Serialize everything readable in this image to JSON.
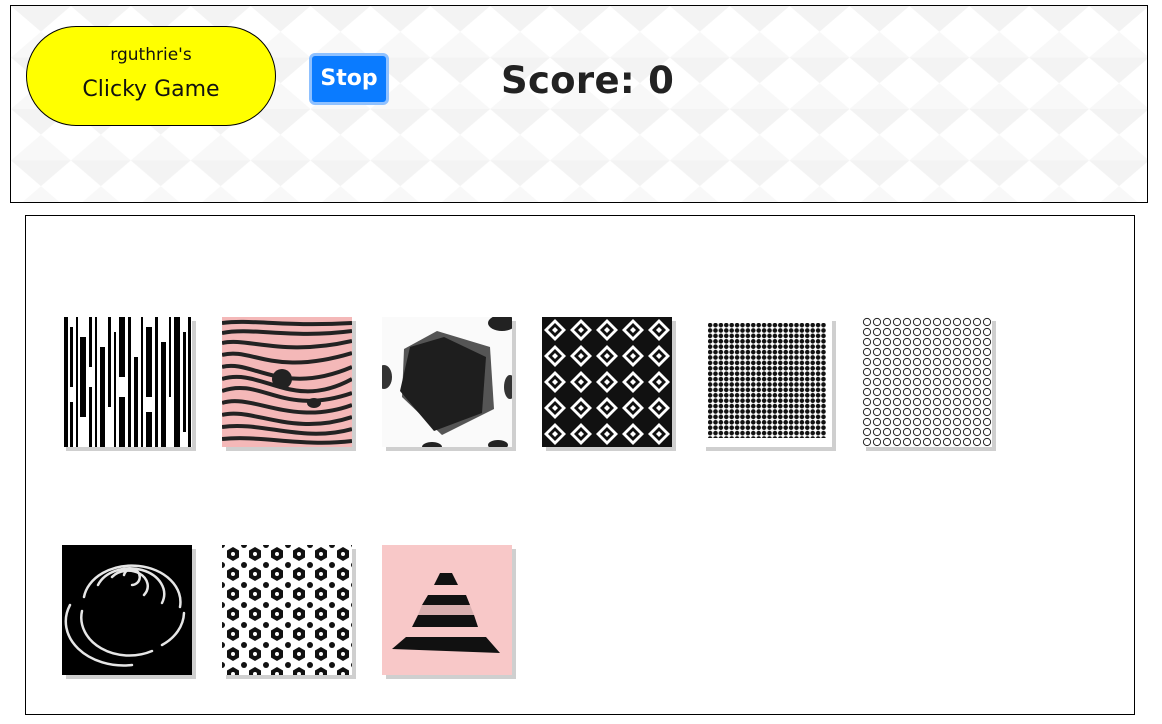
{
  "header": {
    "title_owner": "rguthrie's",
    "title_game": "Clicky Game",
    "stop_label": "Stop",
    "score_label": "Score:",
    "score_value": 0
  },
  "colors": {
    "title_pill": "#ffff00",
    "stop_button": "#0a7bff",
    "card_pink": "#f8c8c8"
  },
  "cards": [
    {
      "pattern": "vertical-bars-pattern"
    },
    {
      "pattern": "pink-wave-pattern"
    },
    {
      "pattern": "black-pentagon-pattern"
    },
    {
      "pattern": "diamond-lattice-pattern"
    },
    {
      "pattern": "dot-grid-pattern"
    },
    {
      "pattern": "circle-grid-pattern"
    },
    {
      "pattern": "spiral-arcs-pattern"
    },
    {
      "pattern": "hexagon-lattice-pattern"
    },
    {
      "pattern": "pink-pyramid-pattern"
    }
  ]
}
